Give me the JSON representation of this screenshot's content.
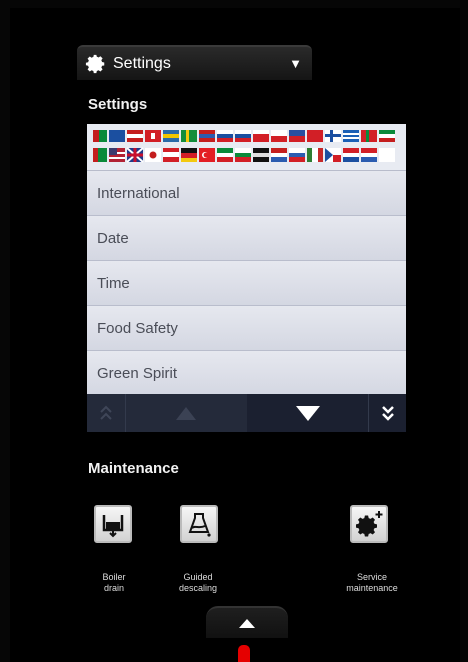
{
  "header": {
    "title": "Settings",
    "icon": "gear-icon",
    "caret": "chevron-down-icon"
  },
  "settings_section": {
    "title": "Settings"
  },
  "settings_list": {
    "items": [
      "International",
      "Date",
      "Time",
      "Food Safety",
      "Green Spirit"
    ]
  },
  "maintenance_section": {
    "title": "Maintenance",
    "tiles": [
      {
        "label_line1": "Boiler",
        "label_line2": "drain",
        "icon": "boiler-drain-icon"
      },
      {
        "label_line1": "Guided",
        "label_line2": "descaling",
        "icon": "descaling-icon"
      },
      {
        "label_line1": "Service",
        "label_line2": "maintenance",
        "icon": "service-gear-icon"
      }
    ]
  },
  "colors": {
    "panel": "#d8dbe6",
    "navbar": "#242a3a",
    "indicator": "#e50000"
  }
}
